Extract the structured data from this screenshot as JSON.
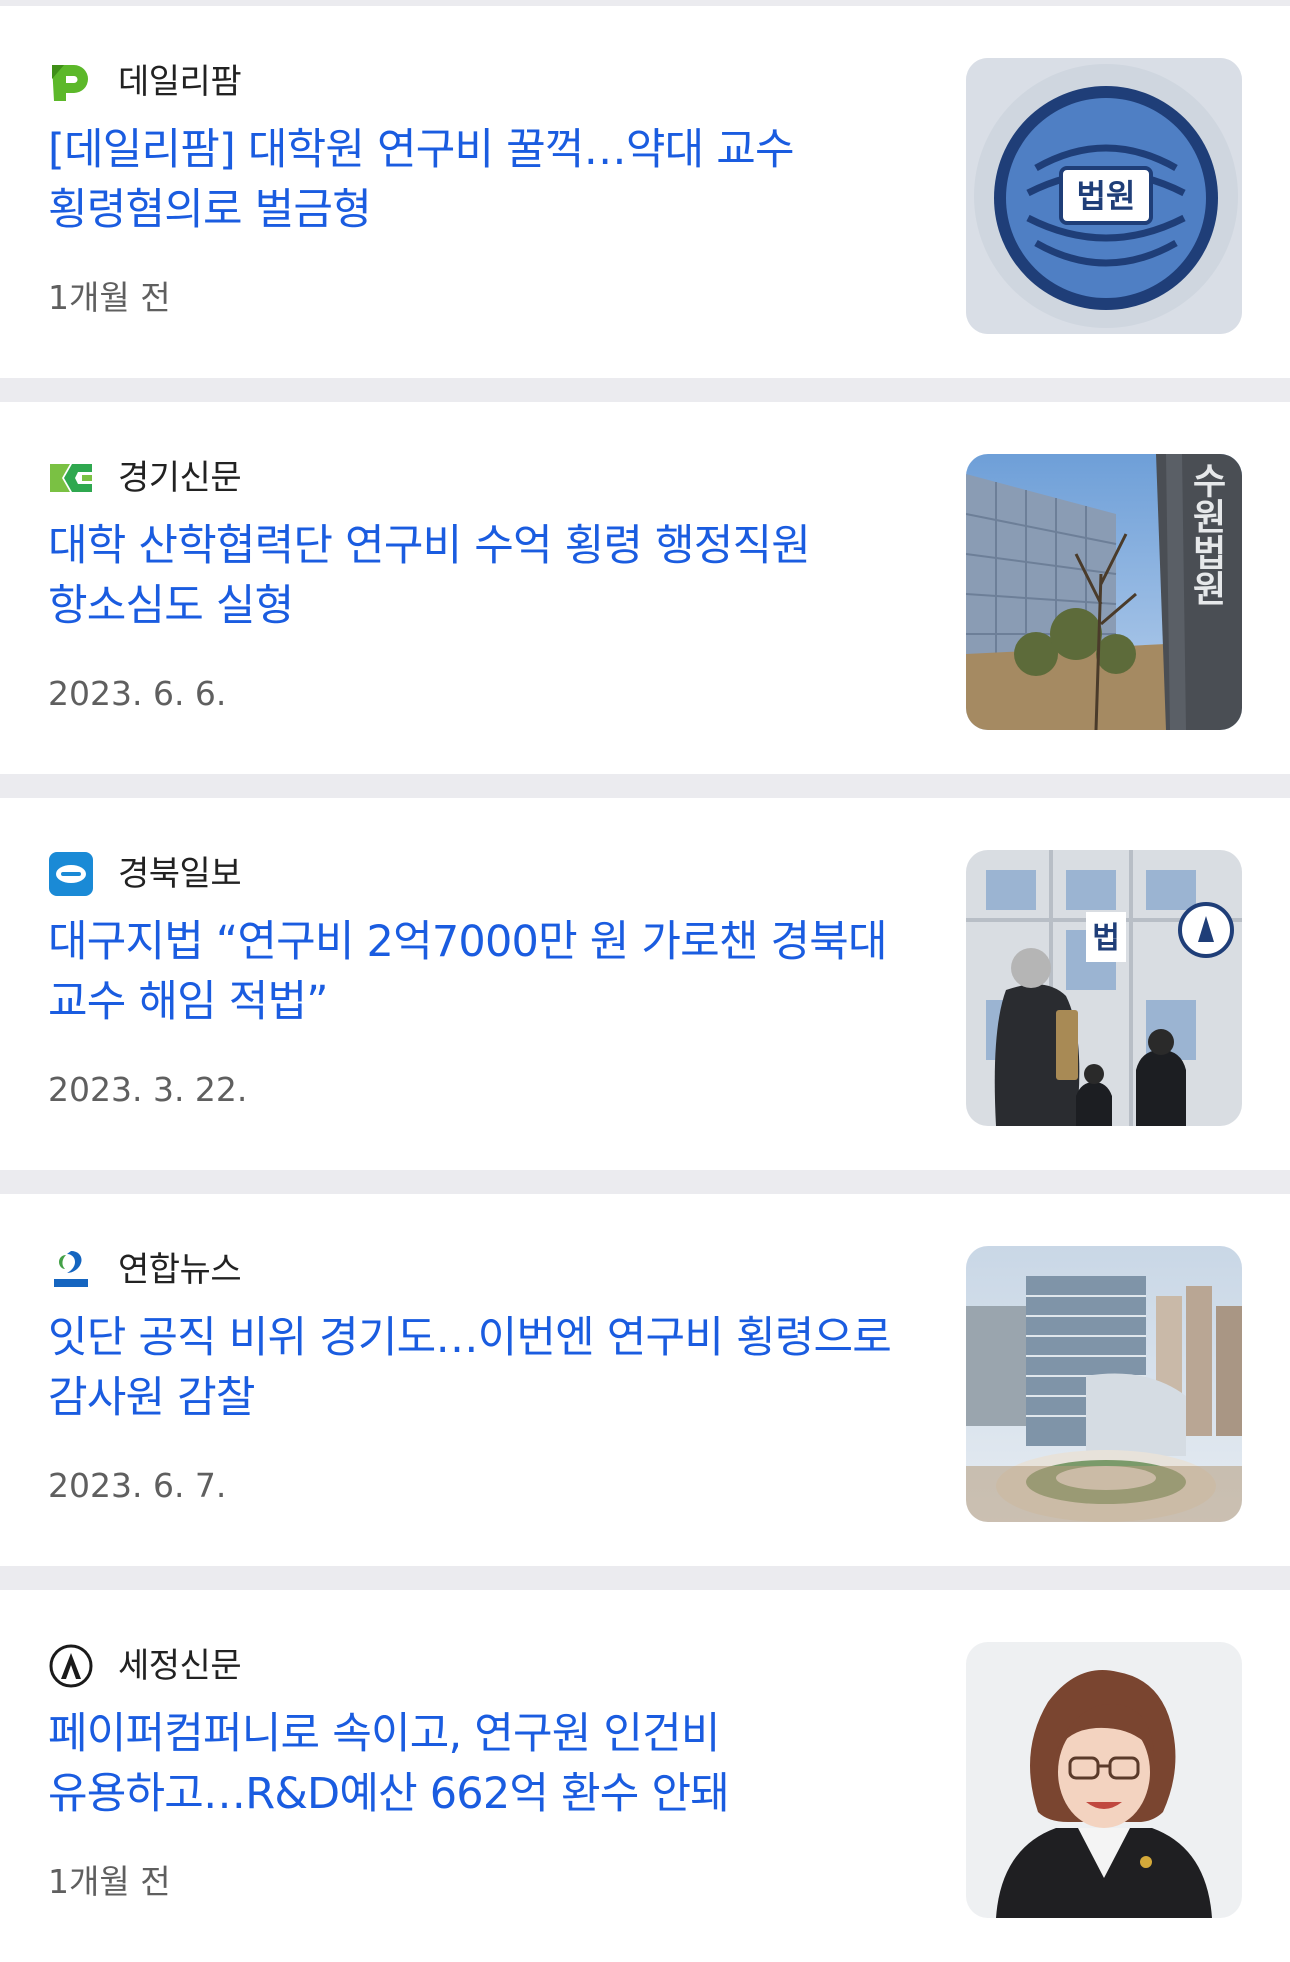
{
  "articles": [
    {
      "source": "데일리팜",
      "source_icon": "dailypharm-logo-icon",
      "title": "[데일리팜] 대학원 연구비 꿀꺽…약대 교수 횡령혐의로 벌금형",
      "time": "1개월 전",
      "thumbnail_badge": "법원"
    },
    {
      "source": "경기신문",
      "source_icon": "kgnews-logo-icon",
      "title": "대학 산학협력단 연구비 수억 횡령 행정직원 항소심도 실형",
      "time": "2023. 6. 6.",
      "thumbnail_sign": "수원법원"
    },
    {
      "source": "경북일보",
      "source_icon": "kyongbuk-logo-icon",
      "title": "대구지법 “연구비 2억7000만 원 가로챈 경북대 교수 해임 적법”",
      "time": "2023. 3. 22.",
      "thumbnail_sign": "법"
    },
    {
      "source": "연합뉴스",
      "source_icon": "yonhap-logo-icon",
      "title": "잇단 공직 비위 경기도…이번엔 연구비 횡령으로 감사원 감찰",
      "time": "2023. 6. 7."
    },
    {
      "source": "세정신문",
      "source_icon": "sejung-logo-icon",
      "title": "페이퍼컴퍼니로 속이고, 연구원 인건비 유용하고…R&D예산 662억 환수 안돼",
      "time": "1개월 전"
    }
  ],
  "colors": {
    "headline": "#1a5ce0",
    "separator": "#ebebef",
    "card": "#ffffff"
  }
}
